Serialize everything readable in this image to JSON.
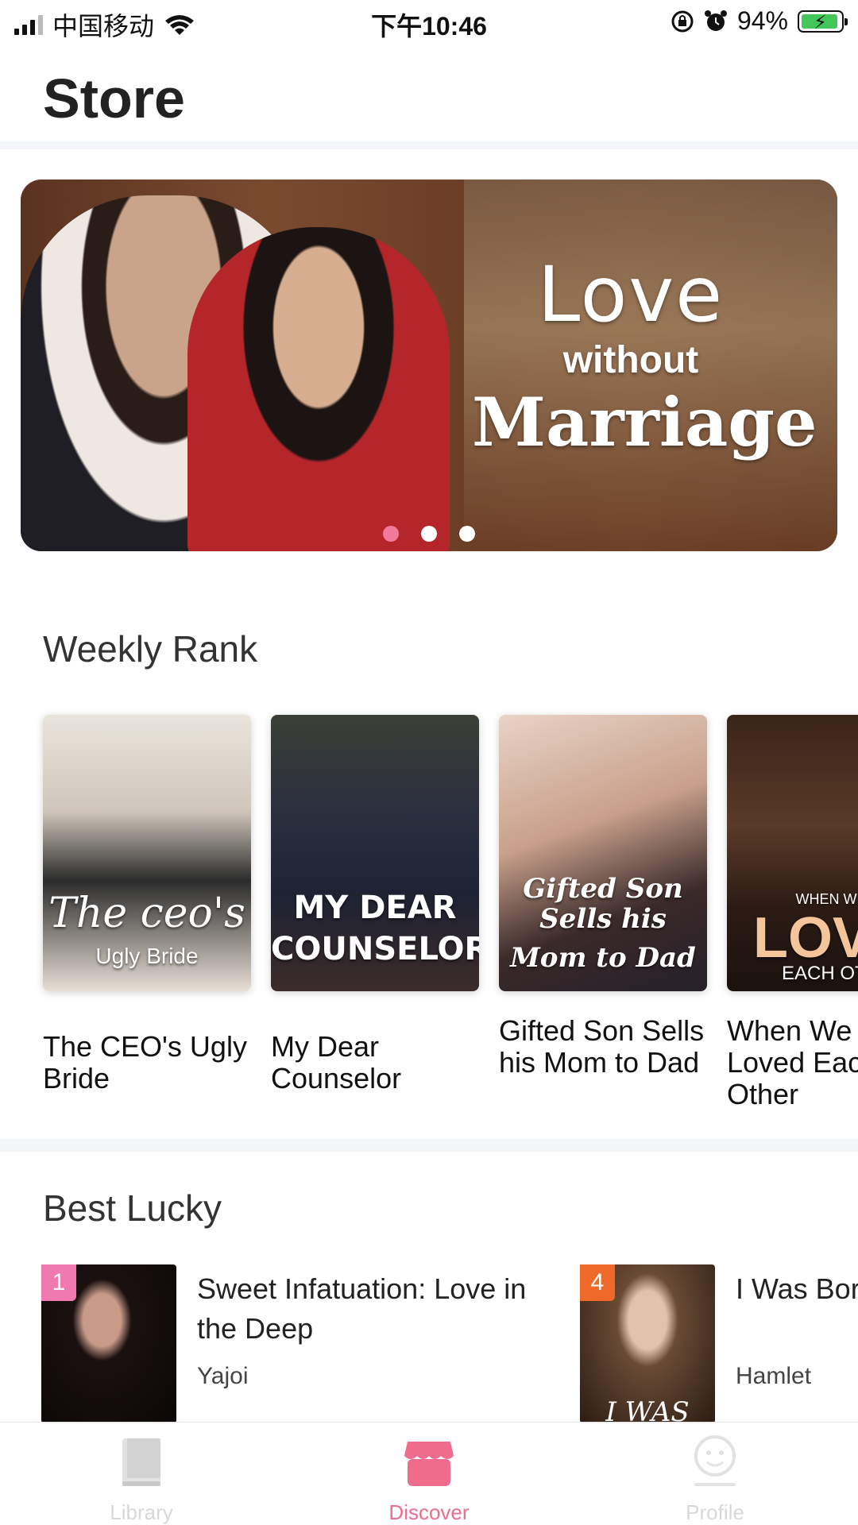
{
  "status_bar": {
    "carrier": "中国移动",
    "time": "下午10:46",
    "battery_percent": "94%",
    "battery_level": 0.94
  },
  "header": {
    "title": "Store"
  },
  "banner": {
    "line1": "Love",
    "line2": "without",
    "line3": "Marriage",
    "active_dot": 0,
    "dots": 3
  },
  "weekly_rank": {
    "title": "Weekly Rank",
    "books": [
      {
        "title": "The CEO's Ugly Bride",
        "cover_text": "The ceo's",
        "cover_sub": "Ugly Bride"
      },
      {
        "title": "My Dear Counselor",
        "cover_text": "MY DEAR",
        "cover_sub": "COUNSELOR"
      },
      {
        "title": "Gifted Son Sells his Mom to Dad",
        "cover_text": "Gifted Son Sells his",
        "cover_sub": "Mom to Dad"
      },
      {
        "title": "When We Loved Each Other",
        "cover_text": "WHEN WE",
        "cover_sub": "LOVE",
        "cover_sub2": "EACH OTH"
      }
    ]
  },
  "best_lucky": {
    "title": "Best Lucky",
    "items": [
      {
        "rank": "1",
        "title": "Sweet Infatuation: Love in the Deep",
        "author": "Yajoi",
        "rank_color": "#f07ab0"
      },
      {
        "rank": "4",
        "title": "I Was Born with Silver Spoons",
        "author": "Hamlet",
        "rank_color": "#ef6a2a",
        "cover_text": "I WAS"
      }
    ]
  },
  "tabs": [
    {
      "label": "Library",
      "icon": "book-icon"
    },
    {
      "label": "Discover",
      "icon": "store-icon",
      "active": true
    },
    {
      "label": "Profile",
      "icon": "profile-icon"
    }
  ],
  "colors": {
    "accent": "#f06c8c",
    "active_dot": "#f07a9b",
    "divider": "#f4f5f8"
  }
}
